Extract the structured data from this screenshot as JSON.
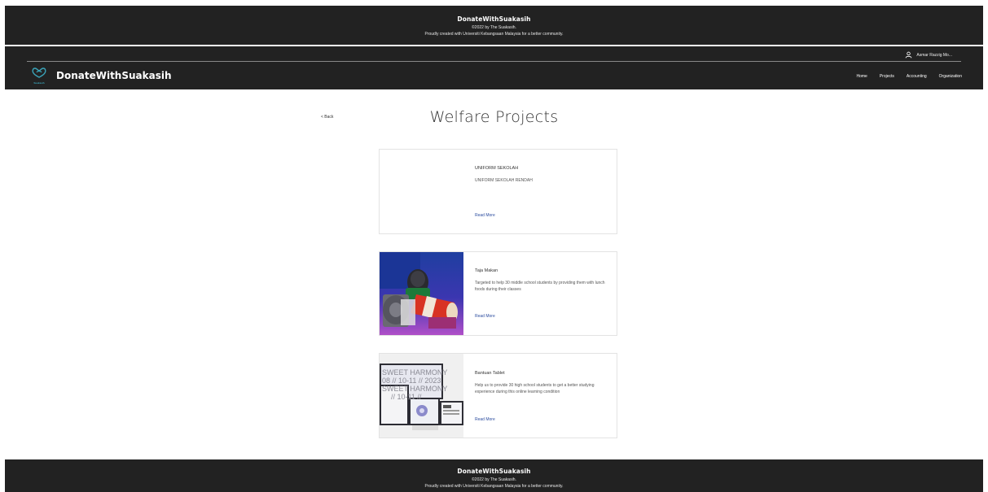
{
  "top_footer": {
    "brand": "DonateWithSuakasih",
    "copyright": "©2022 by The Suakasih.",
    "credit": "Proudly created with Universiti Kebangsaan Malaysia for a better community."
  },
  "header": {
    "user_name": "Asmar Razzig Mo...",
    "logo_text": "Suakasih",
    "site_title": "DonateWithSuakasih",
    "nav": [
      "Home",
      "Projects",
      "Accounting",
      "Organization"
    ]
  },
  "page": {
    "back_label": "< Back",
    "title": "Welfare Projects"
  },
  "projects": [
    {
      "title": "UNIFORM SEKOLAH",
      "description": "UNIFORM SEKOLAH RENDAH",
      "read_more": "Read More"
    },
    {
      "title": "Taja Makan",
      "description": "Targeted to help 30 middle school students by providing them with lunch foods during their classes",
      "read_more": "Read More"
    },
    {
      "title": "Bantuan Tablet",
      "description": "Help us to provide 30 high school students to get a better studying experience during this online learning condition",
      "read_more": "Read More"
    }
  ],
  "tablet_image_text": {
    "line1": "SWEET HARMONY",
    "line2": "08 // 10-11 // 2023",
    "line3": "SWEET HARMONY",
    "line4": "// 10-11 //"
  },
  "bottom_footer": {
    "brand": "DonateWithSuakasih",
    "copyright": "©2022 by The Suakasih.",
    "credit": "Proudly created with Universiti Kebangsaan Malaysia for a better community."
  },
  "colors": {
    "header_bg": "#222222",
    "link": "#2a4b9e",
    "card_border": "#e3e3e3",
    "logo_accent": "#3aa3b8"
  }
}
